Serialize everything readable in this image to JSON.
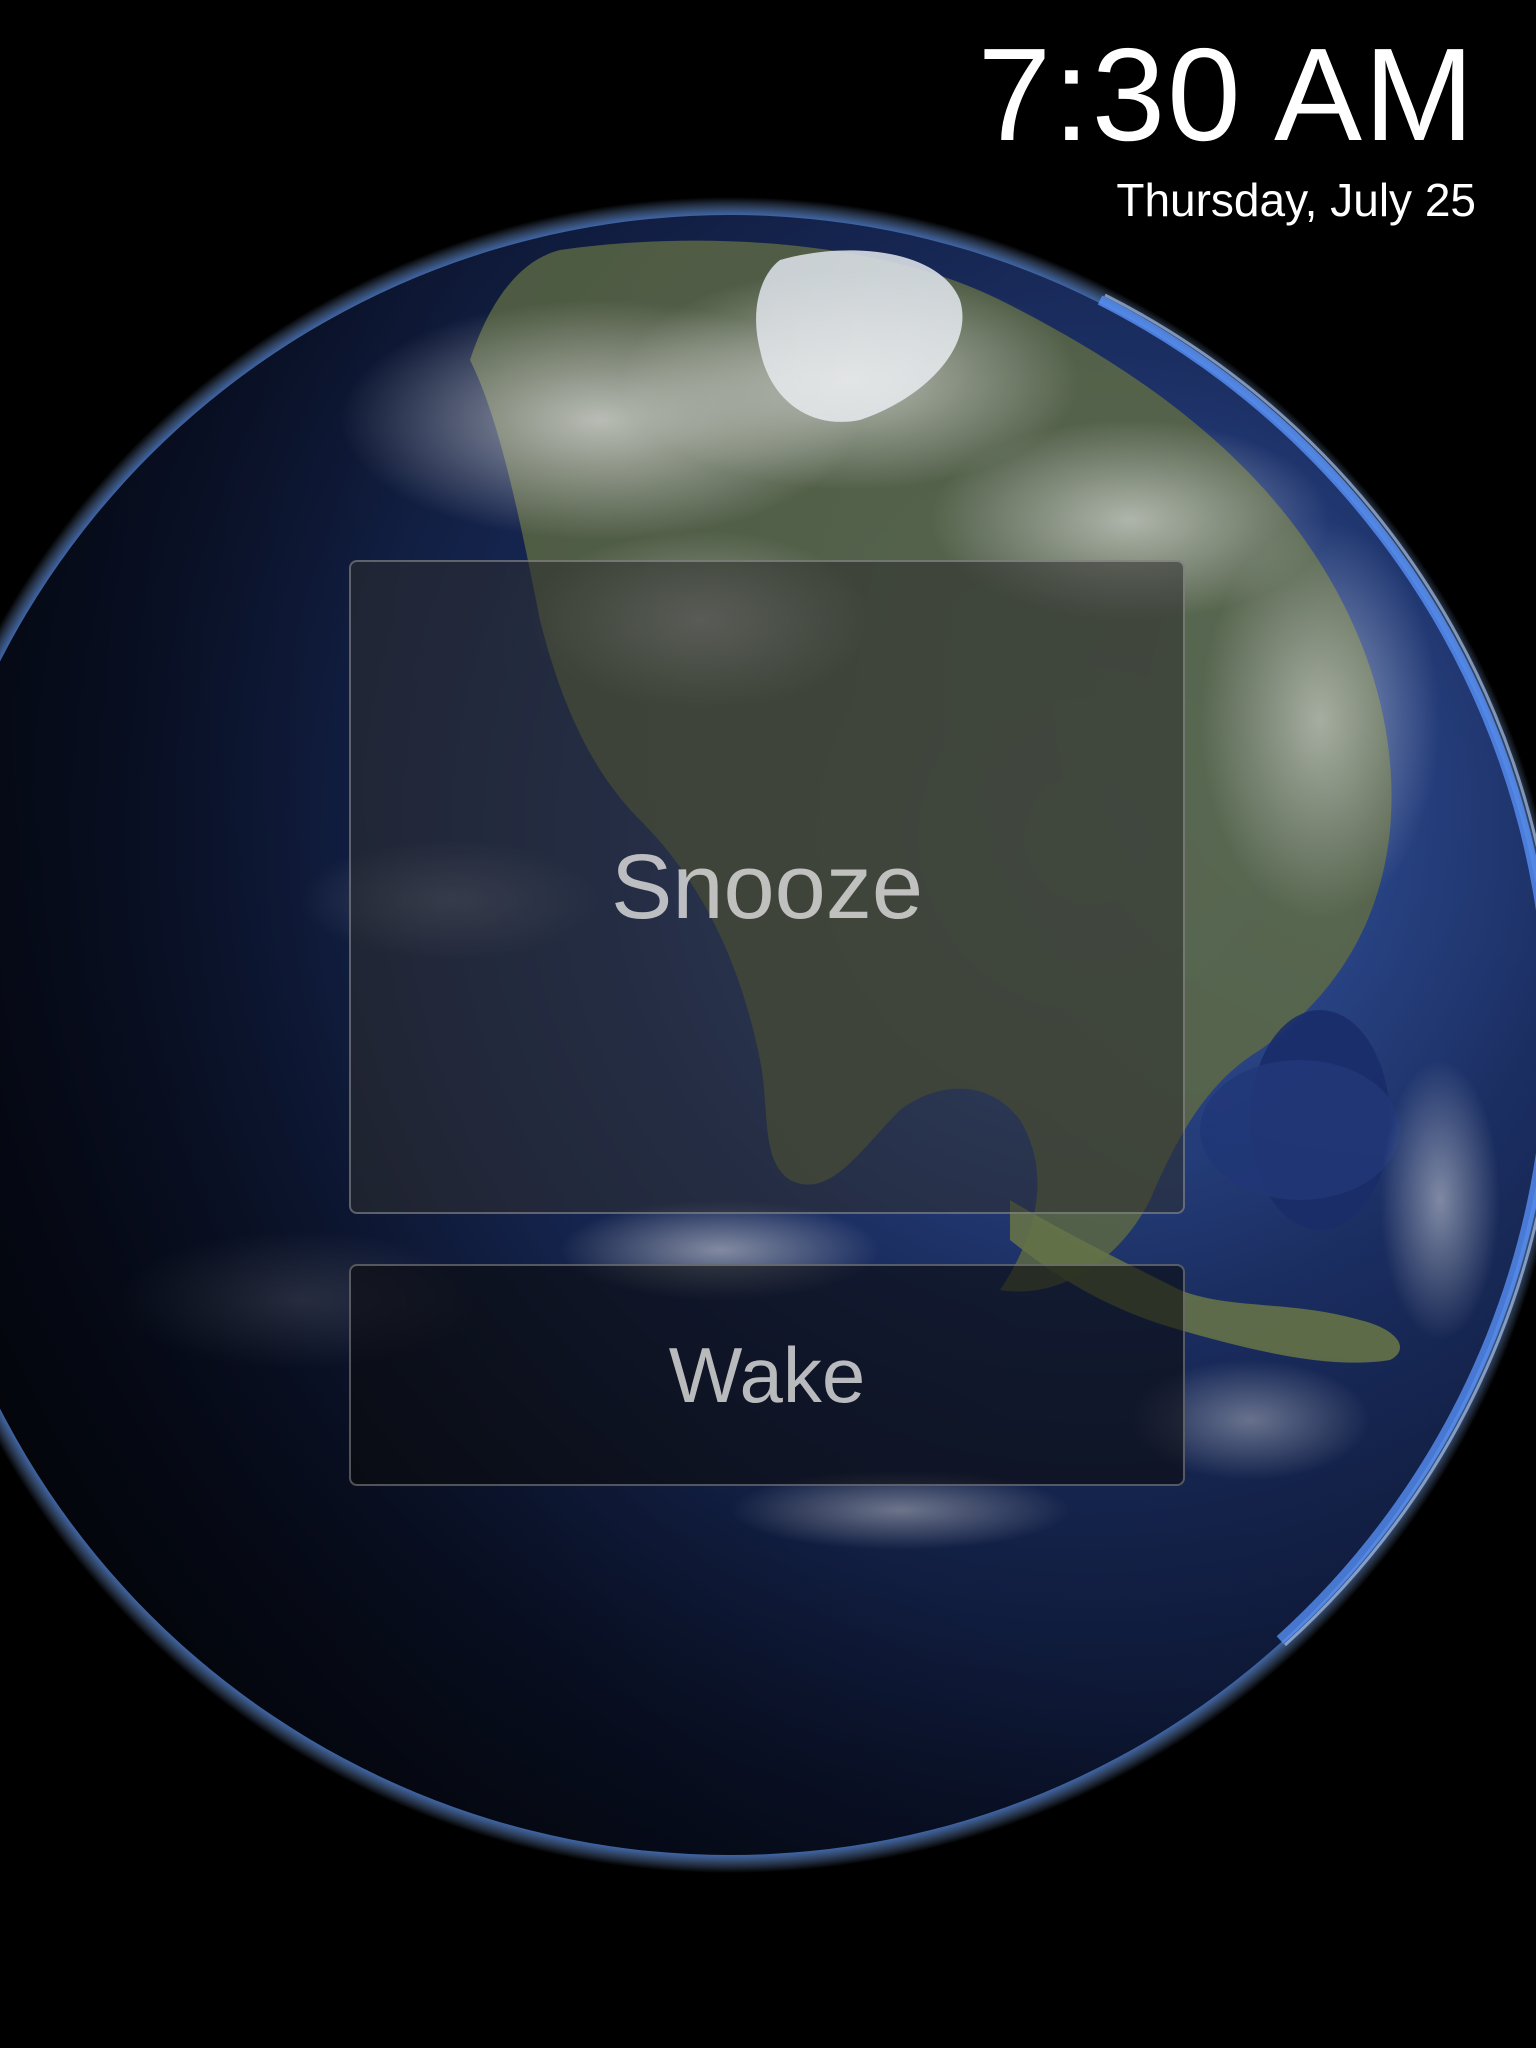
{
  "clock": {
    "time": "7:30 AM",
    "date": "Thursday, July 25"
  },
  "alarm": {
    "snooze_label": "Snooze",
    "wake_label": "Wake"
  },
  "background": {
    "image": "earth-globe"
  }
}
